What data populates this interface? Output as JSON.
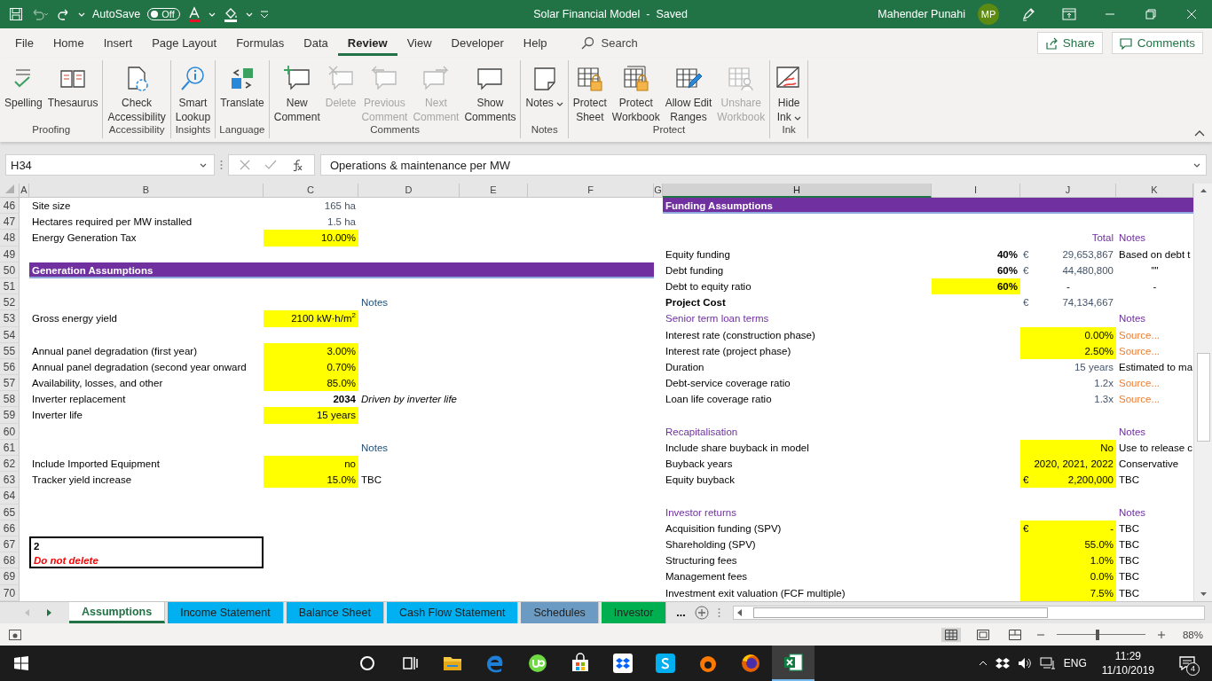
{
  "quick_access": {
    "autosave_label": "AutoSave",
    "autosave": {
      "on": false,
      "label": "Off"
    }
  },
  "window": {
    "title": "Solar Financial Model  -  Saved",
    "user": "Mahender Punahi",
    "avatar": "MP"
  },
  "menu_tabs": [
    {
      "label": "File",
      "selected": false
    },
    {
      "label": "Home",
      "selected": false
    },
    {
      "label": "Insert",
      "selected": false
    },
    {
      "label": "Page Layout",
      "selected": false
    },
    {
      "label": "Formulas",
      "selected": false
    },
    {
      "label": "Data",
      "selected": false
    },
    {
      "label": "Review",
      "selected": true
    },
    {
      "label": "View",
      "selected": false
    },
    {
      "label": "Developer",
      "selected": false
    },
    {
      "label": "Help",
      "selected": false
    }
  ],
  "search": {
    "placeholder": "Search"
  },
  "share_button": "Share",
  "comments_button": "Comments",
  "ribbon_groups": [
    {
      "label": "Proofing",
      "buttons": [
        {
          "label": "Spelling",
          "disabled": false,
          "dropdown": false
        },
        {
          "label": "Thesaurus",
          "disabled": false,
          "dropdown": false
        }
      ]
    },
    {
      "label": "Accessibility",
      "buttons": [
        {
          "label": "Check\nAccessibility",
          "disabled": false,
          "dropdown": false
        }
      ]
    },
    {
      "label": "Insights",
      "buttons": [
        {
          "label": "Smart\nLookup",
          "disabled": false,
          "dropdown": false
        }
      ]
    },
    {
      "label": "Language",
      "buttons": [
        {
          "label": "Translate",
          "disabled": false,
          "dropdown": false
        }
      ]
    },
    {
      "label": "Comments",
      "buttons": [
        {
          "label": "New\nComment",
          "disabled": false,
          "dropdown": false
        },
        {
          "label": "Delete",
          "disabled": true,
          "dropdown": false
        },
        {
          "label": "Previous\nComment",
          "disabled": true,
          "dropdown": false
        },
        {
          "label": "Next\nComment",
          "disabled": true,
          "dropdown": false
        },
        {
          "label": "Show\nComments",
          "disabled": false,
          "dropdown": false
        }
      ]
    },
    {
      "label": "Notes",
      "buttons": [
        {
          "label": "Notes",
          "disabled": false,
          "dropdown": true
        }
      ]
    },
    {
      "label": "Protect",
      "buttons": [
        {
          "label": "Protect\nSheet",
          "disabled": false,
          "dropdown": false
        },
        {
          "label": "Protect\nWorkbook",
          "disabled": false,
          "dropdown": false
        },
        {
          "label": "Allow Edit\nRanges",
          "disabled": false,
          "dropdown": false
        },
        {
          "label": "Unshare\nWorkbook",
          "disabled": true,
          "dropdown": false
        }
      ]
    },
    {
      "label": "Ink",
      "buttons": [
        {
          "label": "Hide\nInk",
          "disabled": false,
          "dropdown": true
        }
      ]
    }
  ],
  "formula_bar": {
    "name_box": "H34",
    "formula": "Operations & maintenance per MW"
  },
  "sheet": {
    "columns": [
      {
        "label": "A",
        "selected": false
      },
      {
        "label": "B",
        "selected": false
      },
      {
        "label": "C",
        "selected": false
      },
      {
        "label": "D",
        "selected": false
      },
      {
        "label": "E",
        "selected": false
      },
      {
        "label": "F",
        "selected": false
      },
      {
        "label": "G",
        "selected": false
      },
      {
        "label": "H",
        "selected": true
      },
      {
        "label": "I",
        "selected": false
      },
      {
        "label": "J",
        "selected": false
      },
      {
        "label": "K",
        "selected": false
      }
    ],
    "rows": [
      {
        "number": "46",
        "left": {
          "label": {
            "text": "Site size",
            "kind": "plain"
          },
          "value": {
            "text": "165 ha",
            "kind": "calc"
          }
        },
        "right": {
          "header": {
            "text": "Funding Assumptions",
            "kind": "header"
          }
        }
      },
      {
        "number": "47",
        "left": {
          "label": {
            "text": "Hectares required per MW installed",
            "kind": "plain"
          },
          "value": {
            "text": "1.5 ha",
            "kind": "calc"
          }
        }
      },
      {
        "number": "48",
        "left": {
          "label": {
            "text": "Energy Generation Tax",
            "kind": "plain"
          },
          "value": {
            "text": "10.00%",
            "kind": "input"
          }
        },
        "right": {
          "total": {
            "text": "Total",
            "kind": "subhead"
          },
          "note": {
            "text": "Notes",
            "kind": "subhead"
          }
        }
      },
      {
        "number": "49",
        "right": {
          "label": {
            "text": "Equity funding",
            "kind": "plain"
          },
          "share": {
            "text": "40%",
            "kind": "bold"
          },
          "total": {
            "unit": "€",
            "text": "29,653,867",
            "kind": "calc"
          },
          "note": {
            "text": "Based on debt t",
            "kind": "plain"
          }
        }
      },
      {
        "number": "50",
        "left": {
          "header": {
            "text": "Generation Assumptions",
            "kind": "header"
          }
        },
        "right": {
          "label": {
            "text": "Debt funding",
            "kind": "plain"
          },
          "share": {
            "text": "60%",
            "kind": "bold"
          },
          "total": {
            "unit": "€",
            "text": "44,480,800",
            "kind": "calc"
          },
          "note": {
            "text": "\"\"",
            "kind": "center"
          }
        }
      },
      {
        "number": "51",
        "right": {
          "label": {
            "text": "Debt to equity ratio",
            "kind": "plain"
          },
          "share": {
            "text": "60%",
            "kind": "bold-input"
          },
          "total": {
            "text": "-",
            "kind": "center"
          },
          "note": {
            "text": "-",
            "kind": "center"
          }
        }
      },
      {
        "number": "52",
        "left": {
          "note": {
            "text": "Notes",
            "kind": "notes-head"
          }
        },
        "right": {
          "label": {
            "text": "Project Cost",
            "kind": "bold"
          },
          "total": {
            "unit": "€",
            "text": "74,134,667",
            "kind": "calc"
          }
        }
      },
      {
        "number": "53",
        "left": {
          "label": {
            "text": "Gross energy yield",
            "kind": "plain"
          },
          "value": {
            "text": "2100 kW·h/m$^{2}$",
            "kind": "input"
          }
        },
        "right": {
          "label": {
            "text": "Senior term loan terms",
            "kind": "subhead"
          },
          "note": {
            "text": "Notes",
            "kind": "subhead"
          }
        }
      },
      {
        "number": "54",
        "right": {
          "label": {
            "text": "Interest rate (construction phase)",
            "kind": "plain"
          },
          "total": {
            "text": "0.00%",
            "kind": "input"
          },
          "note": {
            "text": "Source...",
            "kind": "source"
          }
        }
      },
      {
        "number": "55",
        "left": {
          "label": {
            "text": "Annual panel degradation (first year)",
            "kind": "plain"
          },
          "value": {
            "text": "3.00%",
            "kind": "input"
          }
        },
        "right": {
          "label": {
            "text": "Interest rate (project phase)",
            "kind": "plain"
          },
          "total": {
            "text": "2.50%",
            "kind": "input"
          },
          "note": {
            "text": "Source...",
            "kind": "source"
          }
        }
      },
      {
        "number": "56",
        "left": {
          "label": {
            "text": "Annual panel degradation (second year onward",
            "kind": "plain"
          },
          "value": {
            "text": "0.70%",
            "kind": "input"
          }
        },
        "right": {
          "label": {
            "text": "Duration",
            "kind": "plain"
          },
          "total": {
            "text": "15 years",
            "kind": "calc"
          },
          "note": {
            "text": "Estimated to ma",
            "kind": "plain"
          }
        }
      },
      {
        "number": "57",
        "left": {
          "label": {
            "text": "Availability, losses, and other",
            "kind": "plain"
          },
          "value": {
            "text": "85.0%",
            "kind": "input"
          }
        },
        "right": {
          "label": {
            "text": "Debt-service coverage ratio",
            "kind": "plain"
          },
          "total": {
            "text": "1.2x",
            "kind": "calc"
          },
          "note": {
            "text": "Source...",
            "kind": "source"
          }
        }
      },
      {
        "number": "58",
        "left": {
          "label": {
            "text": "Inverter replacement",
            "kind": "plain"
          },
          "value": {
            "text": "2034",
            "kind": "bold"
          },
          "note": {
            "text": "Driven by inverter life",
            "kind": "italic"
          }
        },
        "right": {
          "label": {
            "text": "Loan life coverage ratio",
            "kind": "plain"
          },
          "total": {
            "text": "1.3x",
            "kind": "calc"
          },
          "note": {
            "text": "Source...",
            "kind": "source"
          }
        }
      },
      {
        "number": "59",
        "left": {
          "label": {
            "text": "Inverter life",
            "kind": "plain"
          },
          "value": {
            "text": "15 years",
            "kind": "input"
          }
        }
      },
      {
        "number": "60",
        "right": {
          "label": {
            "text": "Recapitalisation",
            "kind": "subhead"
          },
          "note": {
            "text": "Notes",
            "kind": "subhead"
          }
        }
      },
      {
        "number": "61",
        "left": {
          "note": {
            "text": "Notes",
            "kind": "notes-head"
          }
        },
        "right": {
          "label": {
            "text": "Include share buyback in model",
            "kind": "plain"
          },
          "total": {
            "text": "No",
            "kind": "input"
          },
          "note": {
            "text": "Use to release c",
            "kind": "plain"
          }
        }
      },
      {
        "number": "62",
        "left": {
          "label": {
            "text": "Include Imported Equipment",
            "kind": "plain"
          },
          "value": {
            "text": "no",
            "kind": "input"
          }
        },
        "right": {
          "label": {
            "text": "Buyback years",
            "kind": "plain"
          },
          "total": {
            "text": "2020, 2021, 2022",
            "kind": "input"
          },
          "note": {
            "text": "Conservative",
            "kind": "plain"
          }
        }
      },
      {
        "number": "63",
        "left": {
          "label": {
            "text": "Tracker yield increase",
            "kind": "plain"
          },
          "value": {
            "text": "15.0%",
            "kind": "input"
          },
          "note": {
            "text": "TBC",
            "kind": "plain"
          }
        },
        "right": {
          "label": {
            "text": "Equity buyback",
            "kind": "plain"
          },
          "total": {
            "unit": "€",
            "text": "2,200,000",
            "kind": "input"
          },
          "note": {
            "text": "TBC",
            "kind": "plain"
          }
        }
      },
      {
        "number": "64"
      },
      {
        "number": "65",
        "right": {
          "label": {
            "text": "Investor returns",
            "kind": "subhead"
          },
          "note": {
            "text": "Notes",
            "kind": "subhead"
          }
        }
      },
      {
        "number": "66",
        "right": {
          "label": {
            "text": "Acquisition funding (SPV)",
            "kind": "plain"
          },
          "total": {
            "unit": "€",
            "text": "-",
            "kind": "input"
          },
          "note": {
            "text": "TBC",
            "kind": "plain"
          }
        }
      },
      {
        "number": "67",
        "left": {
          "label": {
            "text": "2",
            "kind": "boxed-top"
          }
        },
        "right": {
          "label": {
            "text": "Shareholding (SPV)",
            "kind": "plain"
          },
          "total": {
            "text": "55.0%",
            "kind": "input"
          },
          "note": {
            "text": "TBC",
            "kind": "plain"
          }
        }
      },
      {
        "number": "68",
        "left": {
          "label": {
            "text": "Do not delete",
            "kind": "boxed-warning"
          }
        },
        "right": {
          "label": {
            "text": "Structuring fees",
            "kind": "plain"
          },
          "total": {
            "text": "1.0%",
            "kind": "input"
          },
          "note": {
            "text": "TBC",
            "kind": "plain"
          }
        }
      },
      {
        "number": "69",
        "right": {
          "label": {
            "text": "Management fees",
            "kind": "plain"
          },
          "total": {
            "text": "0.0%",
            "kind": "input"
          },
          "note": {
            "text": "TBC",
            "kind": "plain"
          }
        }
      },
      {
        "number": "70",
        "right": {
          "label": {
            "text": "Investment exit valuation (FCF multiple)",
            "kind": "plain"
          },
          "total": {
            "text": "7.5%",
            "kind": "input"
          },
          "note": {
            "text": "TBC",
            "kind": "plain"
          }
        }
      }
    ]
  },
  "sheet_tabs": [
    {
      "label": "Assumptions",
      "selected": true
    },
    {
      "label": "Income Statement",
      "selected": false,
      "color": "#00b0f0"
    },
    {
      "label": "Balance Sheet",
      "selected": false,
      "color": "#00b0f0"
    },
    {
      "label": "Cash Flow Statement",
      "selected": false,
      "color": "#00b0f0"
    },
    {
      "label": "Schedules",
      "selected": false,
      "color": "#6b9bc3"
    },
    {
      "label": "Investor",
      "selected": false,
      "color": "#00b050"
    }
  ],
  "more_tabs": "...",
  "status_bar": {
    "zoom": {
      "level": 0.46,
      "label": "88%"
    }
  },
  "taskbar": {
    "apps": [
      {
        "selected": false
      },
      {
        "selected": false
      },
      {
        "selected": false
      },
      {
        "selected": false
      },
      {
        "selected": false
      },
      {
        "selected": false
      },
      {
        "selected": false
      },
      {
        "selected": false
      },
      {
        "selected": false
      },
      {
        "selected": false
      },
      {
        "selected": true
      }
    ],
    "language": "ENG",
    "time": "11:29",
    "date": "11/10/2019",
    "notifications": "4"
  }
}
